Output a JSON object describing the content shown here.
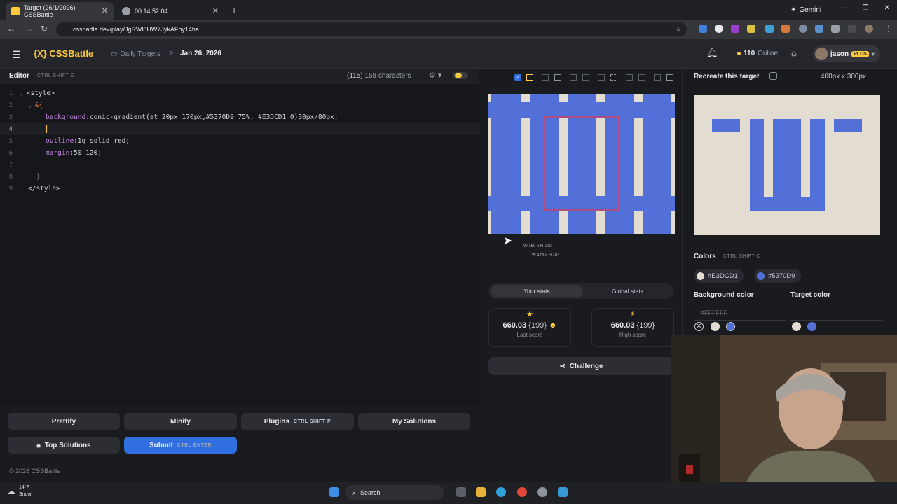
{
  "browser": {
    "tabs": [
      {
        "title": "Target (26/1/2026) - CSSBattle",
        "active": true,
        "favicon_color": "#ffcb3d"
      },
      {
        "title": "00:14:52.04",
        "active": false,
        "favicon_color": "#9aa0a6"
      }
    ],
    "new_tab": "+",
    "close": "✕",
    "gemini_label": "Gemini",
    "url": "cssbattle.dev/play/JgRWl8HW7JykAFby14ha",
    "win_controls": [
      "—",
      "❐",
      "✕"
    ]
  },
  "header": {
    "logo_prefix": "{X}",
    "logo_text": "CSSBattle",
    "breadcrumb_daily": "Daily Targets",
    "breadcrumb_sep": ">",
    "breadcrumb_date": "Jan 26, 2026",
    "online_count": "110",
    "online_label": "Online",
    "username": "jason",
    "plus_badge": "PLUS"
  },
  "editor": {
    "title": "Editor",
    "shortcut": "CTRL  SHIFT  E",
    "char_count": "(115)",
    "char_label": "158 characters",
    "lines": [
      {
        "n": "1",
        "text": "<style>"
      },
      {
        "n": "2",
        "text": "&{"
      },
      {
        "n": "3",
        "prop": "background",
        "value": ":conic-gradient(at 20px 170px,#5370D9 75%, #E3DCD1 0)30px/80px;"
      },
      {
        "n": "4",
        "text": ""
      },
      {
        "n": "5",
        "prop": "outline",
        "value": ":1q solid red;"
      },
      {
        "n": "6",
        "prop": "margin",
        "value": ":50 120;"
      },
      {
        "n": "7",
        "text": ""
      },
      {
        "n": "8",
        "text": "}"
      },
      {
        "n": "9",
        "text": "</style>"
      }
    ]
  },
  "actions": {
    "prettify": "Prettify",
    "minify": "Minify",
    "plugins": "Plugins",
    "plugins_kbd": "CTRL  SHIFT  P",
    "my_solutions": "My Solutions",
    "top_solutions": "Top Solutions",
    "submit": "Submit",
    "submit_kbd": "CTRL  ENTER"
  },
  "footer": {
    "copyright": "© 2026 CSSBattle"
  },
  "preview": {
    "dims_html": "W 160 x H 200",
    "dims_body": "W 144 x H 184",
    "tab_your": "Your stats",
    "tab_global": "Global stats",
    "last_score": "660.03",
    "last_chars": "{199}",
    "last_label": "Last score",
    "high_score": "660.03",
    "high_chars": "{199}",
    "high_label": "High score",
    "challenge": "Challenge",
    "blue": "#5370d9",
    "beige": "#e3dcd1"
  },
  "target": {
    "title": "Recreate this target",
    "size": "400px x 300px",
    "colors_title": "Colors",
    "colors_kbd": "CTRL  SHIFT  C",
    "colors": [
      {
        "name": "#E3DCD1",
        "hex": "#e3dcd1"
      },
      {
        "name": "#5370D9",
        "hex": "#5370d9"
      }
    ],
    "bg_color_label": "Background color",
    "target_color_label": "Target color",
    "bg_placeholder": "#FFFFFF"
  },
  "taskbar": {
    "temp": "14°F",
    "weather": "Snow",
    "search": "Search"
  }
}
